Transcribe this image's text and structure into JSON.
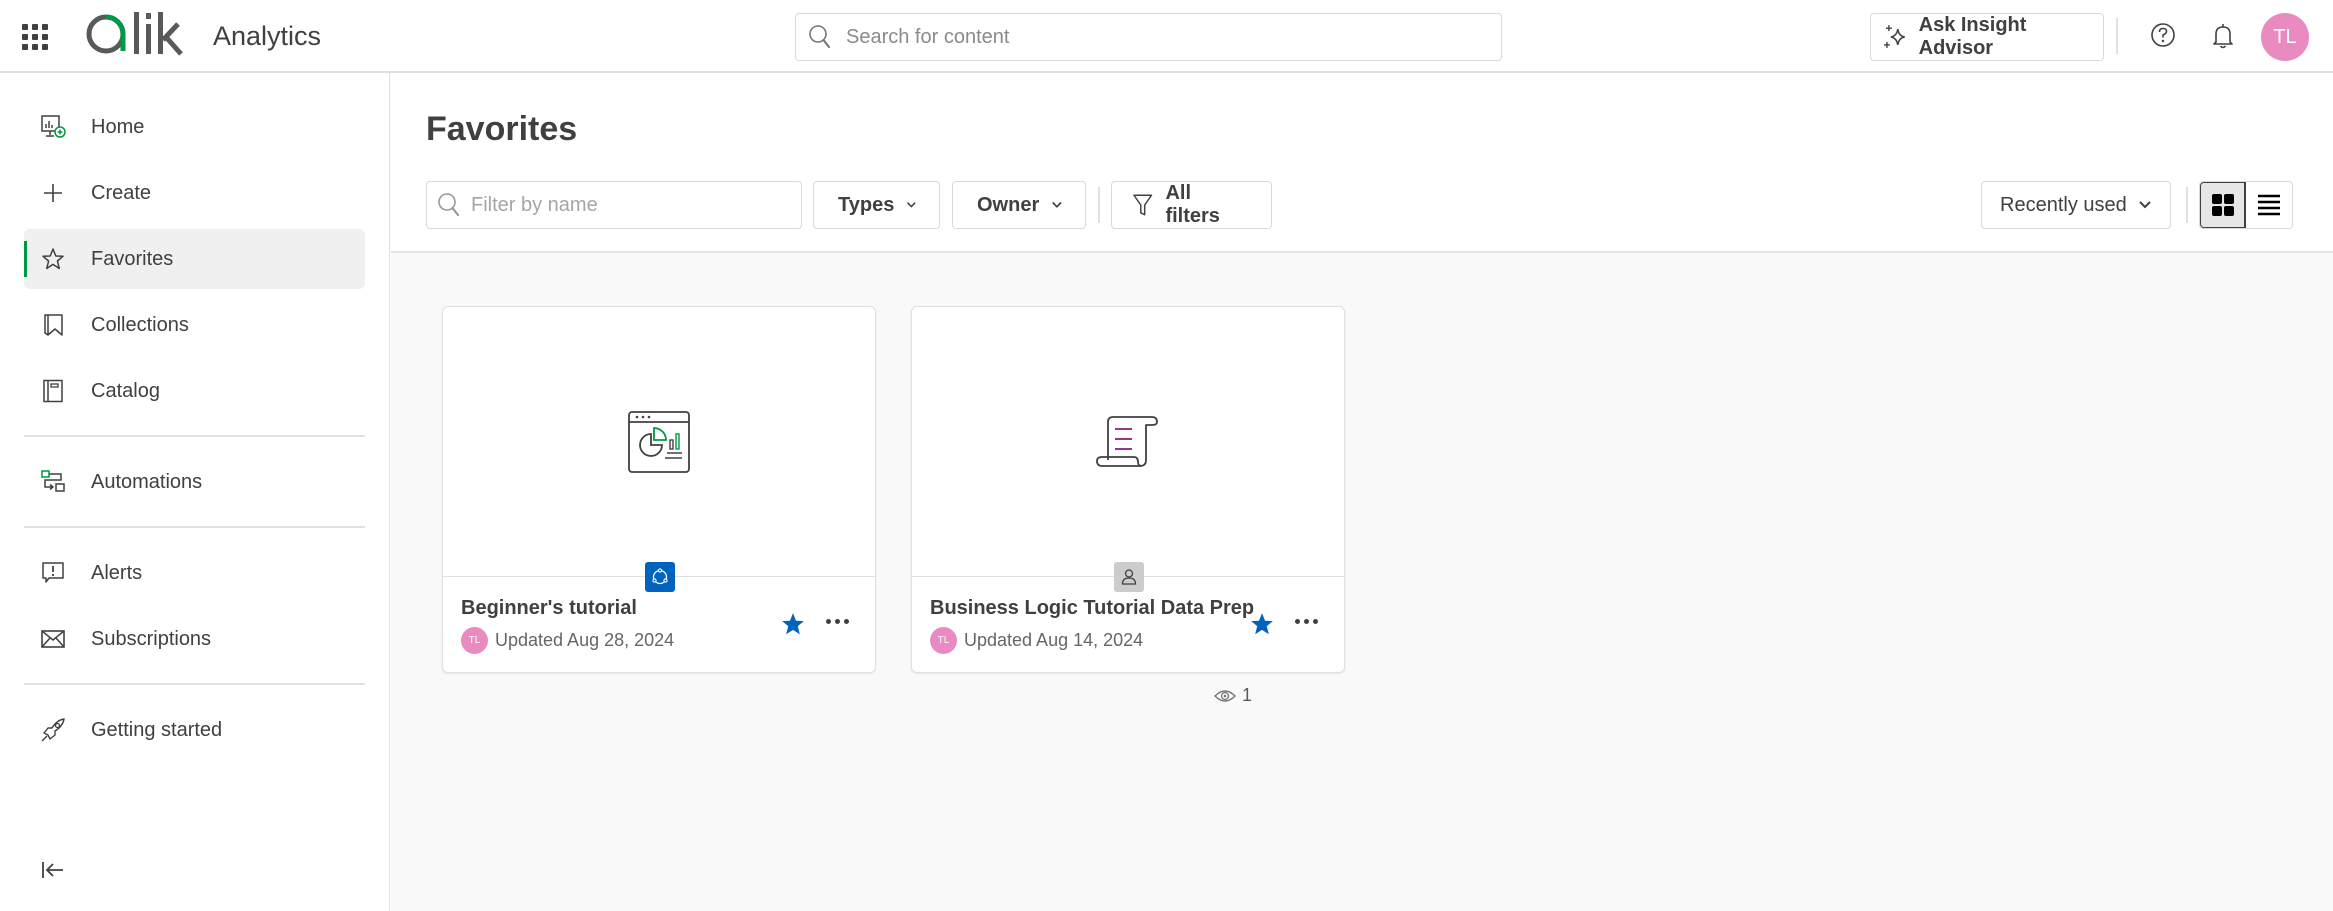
{
  "topbar": {
    "app_name": "Analytics",
    "logo_text": "Qlik",
    "search_placeholder": "Search for content",
    "insight_button": "Ask Insight Advisor",
    "user_initials": "TL",
    "icons": [
      "apps-grid-icon",
      "search-icon",
      "sparkle-icon",
      "help-icon",
      "bell-icon"
    ]
  },
  "sidebar": {
    "items": [
      {
        "label": "Home",
        "icon": "home-monitor-icon"
      },
      {
        "label": "Create",
        "icon": "plus-icon"
      },
      {
        "label": "Favorites",
        "icon": "star-outline-icon",
        "active": true
      },
      {
        "label": "Collections",
        "icon": "bookmark-icon"
      },
      {
        "label": "Catalog",
        "icon": "catalog-icon"
      },
      {
        "label": "Automations",
        "icon": "automation-icon"
      },
      {
        "label": "Alerts",
        "icon": "alert-icon"
      },
      {
        "label": "Subscriptions",
        "icon": "envelope-icon"
      },
      {
        "label": "Getting started",
        "icon": "rocket-icon"
      }
    ],
    "collapse_icon": "collapse-left-icon"
  },
  "main": {
    "title": "Favorites",
    "filter_placeholder": "Filter by name",
    "types_label": "Types",
    "owner_label": "Owner",
    "all_filters_label": "All filters",
    "sort_label": "Recently used",
    "view_modes": [
      "grid",
      "list"
    ],
    "active_view": "grid",
    "cards": [
      {
        "title": "Beginner's tutorial",
        "updated": "Updated Aug 28, 2024",
        "owner_initials": "TL",
        "type_icon": "app-analytics-icon",
        "badge": "shared-space-icon",
        "favorited": true,
        "views": "1"
      },
      {
        "title": "Business Logic Tutorial Data Prep",
        "updated": "Updated Aug 14, 2024",
        "owner_initials": "TL",
        "type_icon": "script-icon",
        "badge": "personal-space-icon",
        "favorited": true
      }
    ]
  },
  "colors": {
    "accent_green": "#009845",
    "favorite_blue": "#0063be",
    "avatar_pink": "#e98bc1",
    "script_purple": "#8b1a7a"
  }
}
